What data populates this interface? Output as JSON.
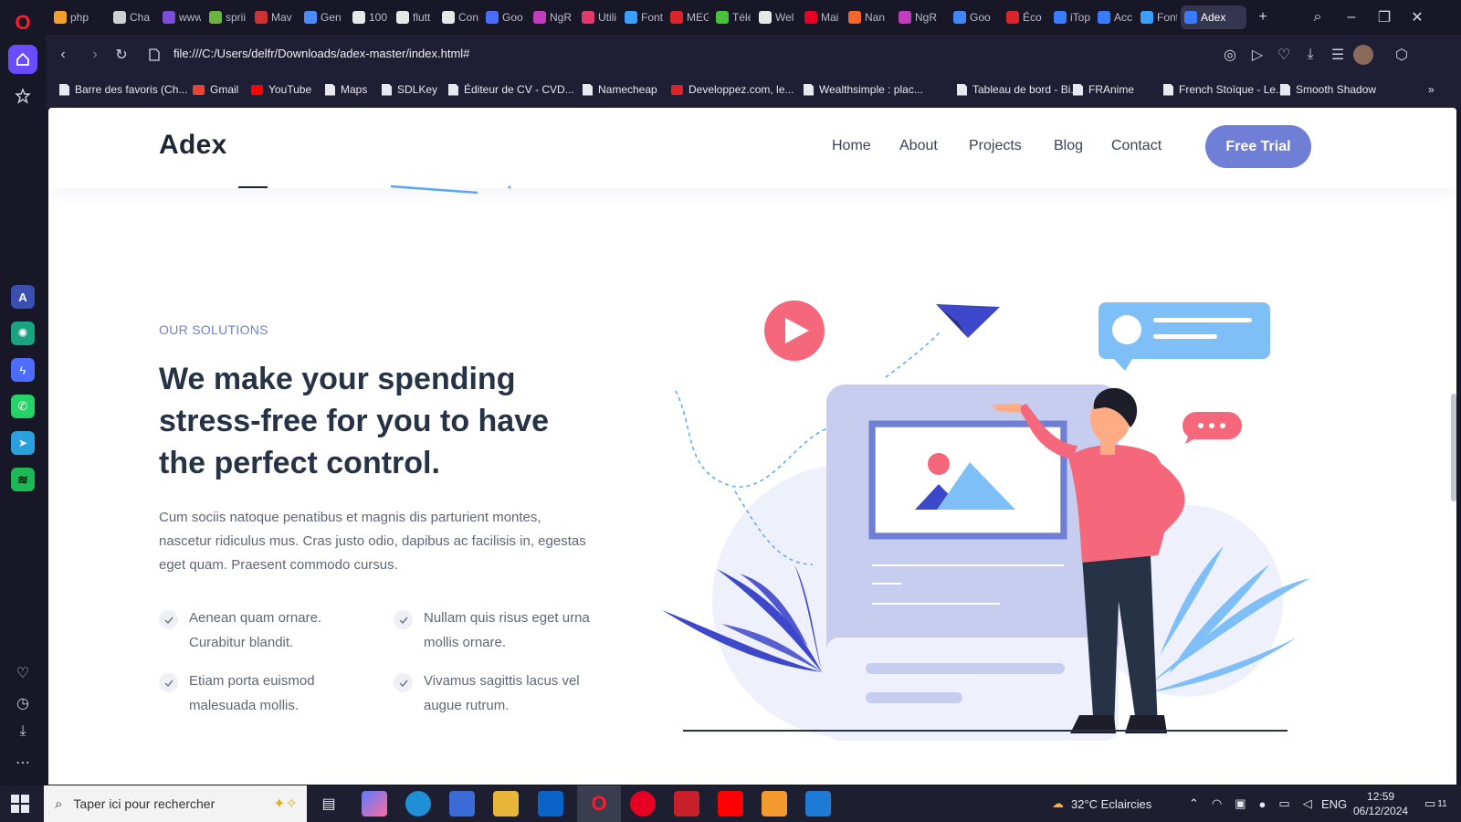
{
  "tabs": [
    {
      "label": "php",
      "color": "#f0a030"
    },
    {
      "label": "Cha",
      "color": "#d0d0d0"
    },
    {
      "label": "www",
      "color": "#7b4dd8"
    },
    {
      "label": "sprii",
      "color": "#6db33f"
    },
    {
      "label": "Mav",
      "color": "#c33"
    },
    {
      "label": "Gen",
      "color": "#4a8cff"
    },
    {
      "label": "100",
      "color": "#e8e8e8"
    },
    {
      "label": "flutt",
      "color": "#e8e8e8"
    },
    {
      "label": "Con",
      "color": "#e8e8e8"
    },
    {
      "label": "Goo",
      "color": "#4a6cff"
    },
    {
      "label": "NgR",
      "color": "#c03dbb"
    },
    {
      "label": "Utili",
      "color": "#e03a6a"
    },
    {
      "label": "Font",
      "color": "#3aa0ff"
    },
    {
      "label": "MEG",
      "color": "#d9252a"
    },
    {
      "label": "Télé",
      "color": "#45c13a"
    },
    {
      "label": "Wel",
      "color": "#e8e8e8"
    },
    {
      "label": "Mai",
      "color": "#e60023"
    },
    {
      "label": "Nan",
      "color": "#f2672a"
    },
    {
      "label": "NgR",
      "color": "#c03dbb"
    },
    {
      "label": "Goo",
      "color": "#4285f4"
    },
    {
      "label": "Éco",
      "color": "#d9252a"
    },
    {
      "label": "iTop",
      "color": "#3a7cff"
    },
    {
      "label": "Acc",
      "color": "#3a7cff"
    },
    {
      "label": "Font",
      "color": "#3aa0ff"
    },
    {
      "label": "Adex",
      "color": "#3a7cff"
    }
  ],
  "address": {
    "url": "file:///C:/Users/delfr/Downloads/adex-master/index.html#"
  },
  "bookmarks": [
    "Barre des favoris (Ch...",
    "Gmail",
    "YouTube",
    "Maps",
    "SDLKey",
    "Éditeur de CV - CVD...",
    "Namecheap",
    "Developpez.com, le...",
    "Wealthsimple : plac...",
    "Tableau de bord - Bi...",
    "FRAnime",
    "French Stoïque - Le...",
    "Smooth Shadow"
  ],
  "site": {
    "brand": "Adex",
    "nav": [
      "Home",
      "About",
      "Projects",
      "Blog",
      "Contact"
    ],
    "cta": "Free Trial",
    "eyebrow": "OUR SOLUTIONS",
    "headline": "We make your spending stress-free for you to have the perfect control.",
    "lead": "Cum sociis natoque penatibus et magnis dis parturient montes, nascetur ridiculus mus. Cras justo odio, dapibus ac facilisis in, egestas eget quam. Praesent commodo cursus.",
    "features": [
      "Aenean quam ornare. Curabitur blandit.",
      "Nullam quis risus eget urna mollis ornare.",
      "Etiam porta euismod malesuada mollis.",
      "Vivamus sagittis lacus vel augue rutrum."
    ]
  },
  "taskbar": {
    "search_placeholder": "Taper ici pour rechercher",
    "weather": "32°C  Eclaircies",
    "language": "ENG",
    "time": "12:59",
    "date": "06/12/2024",
    "notifications": "11"
  },
  "colors": {
    "accent": "#6f7fd6",
    "heading": "#263245",
    "illustration_coral": "#f5677a",
    "illustration_blue": "#3d47c9",
    "illustration_sky": "#7fbff7"
  }
}
